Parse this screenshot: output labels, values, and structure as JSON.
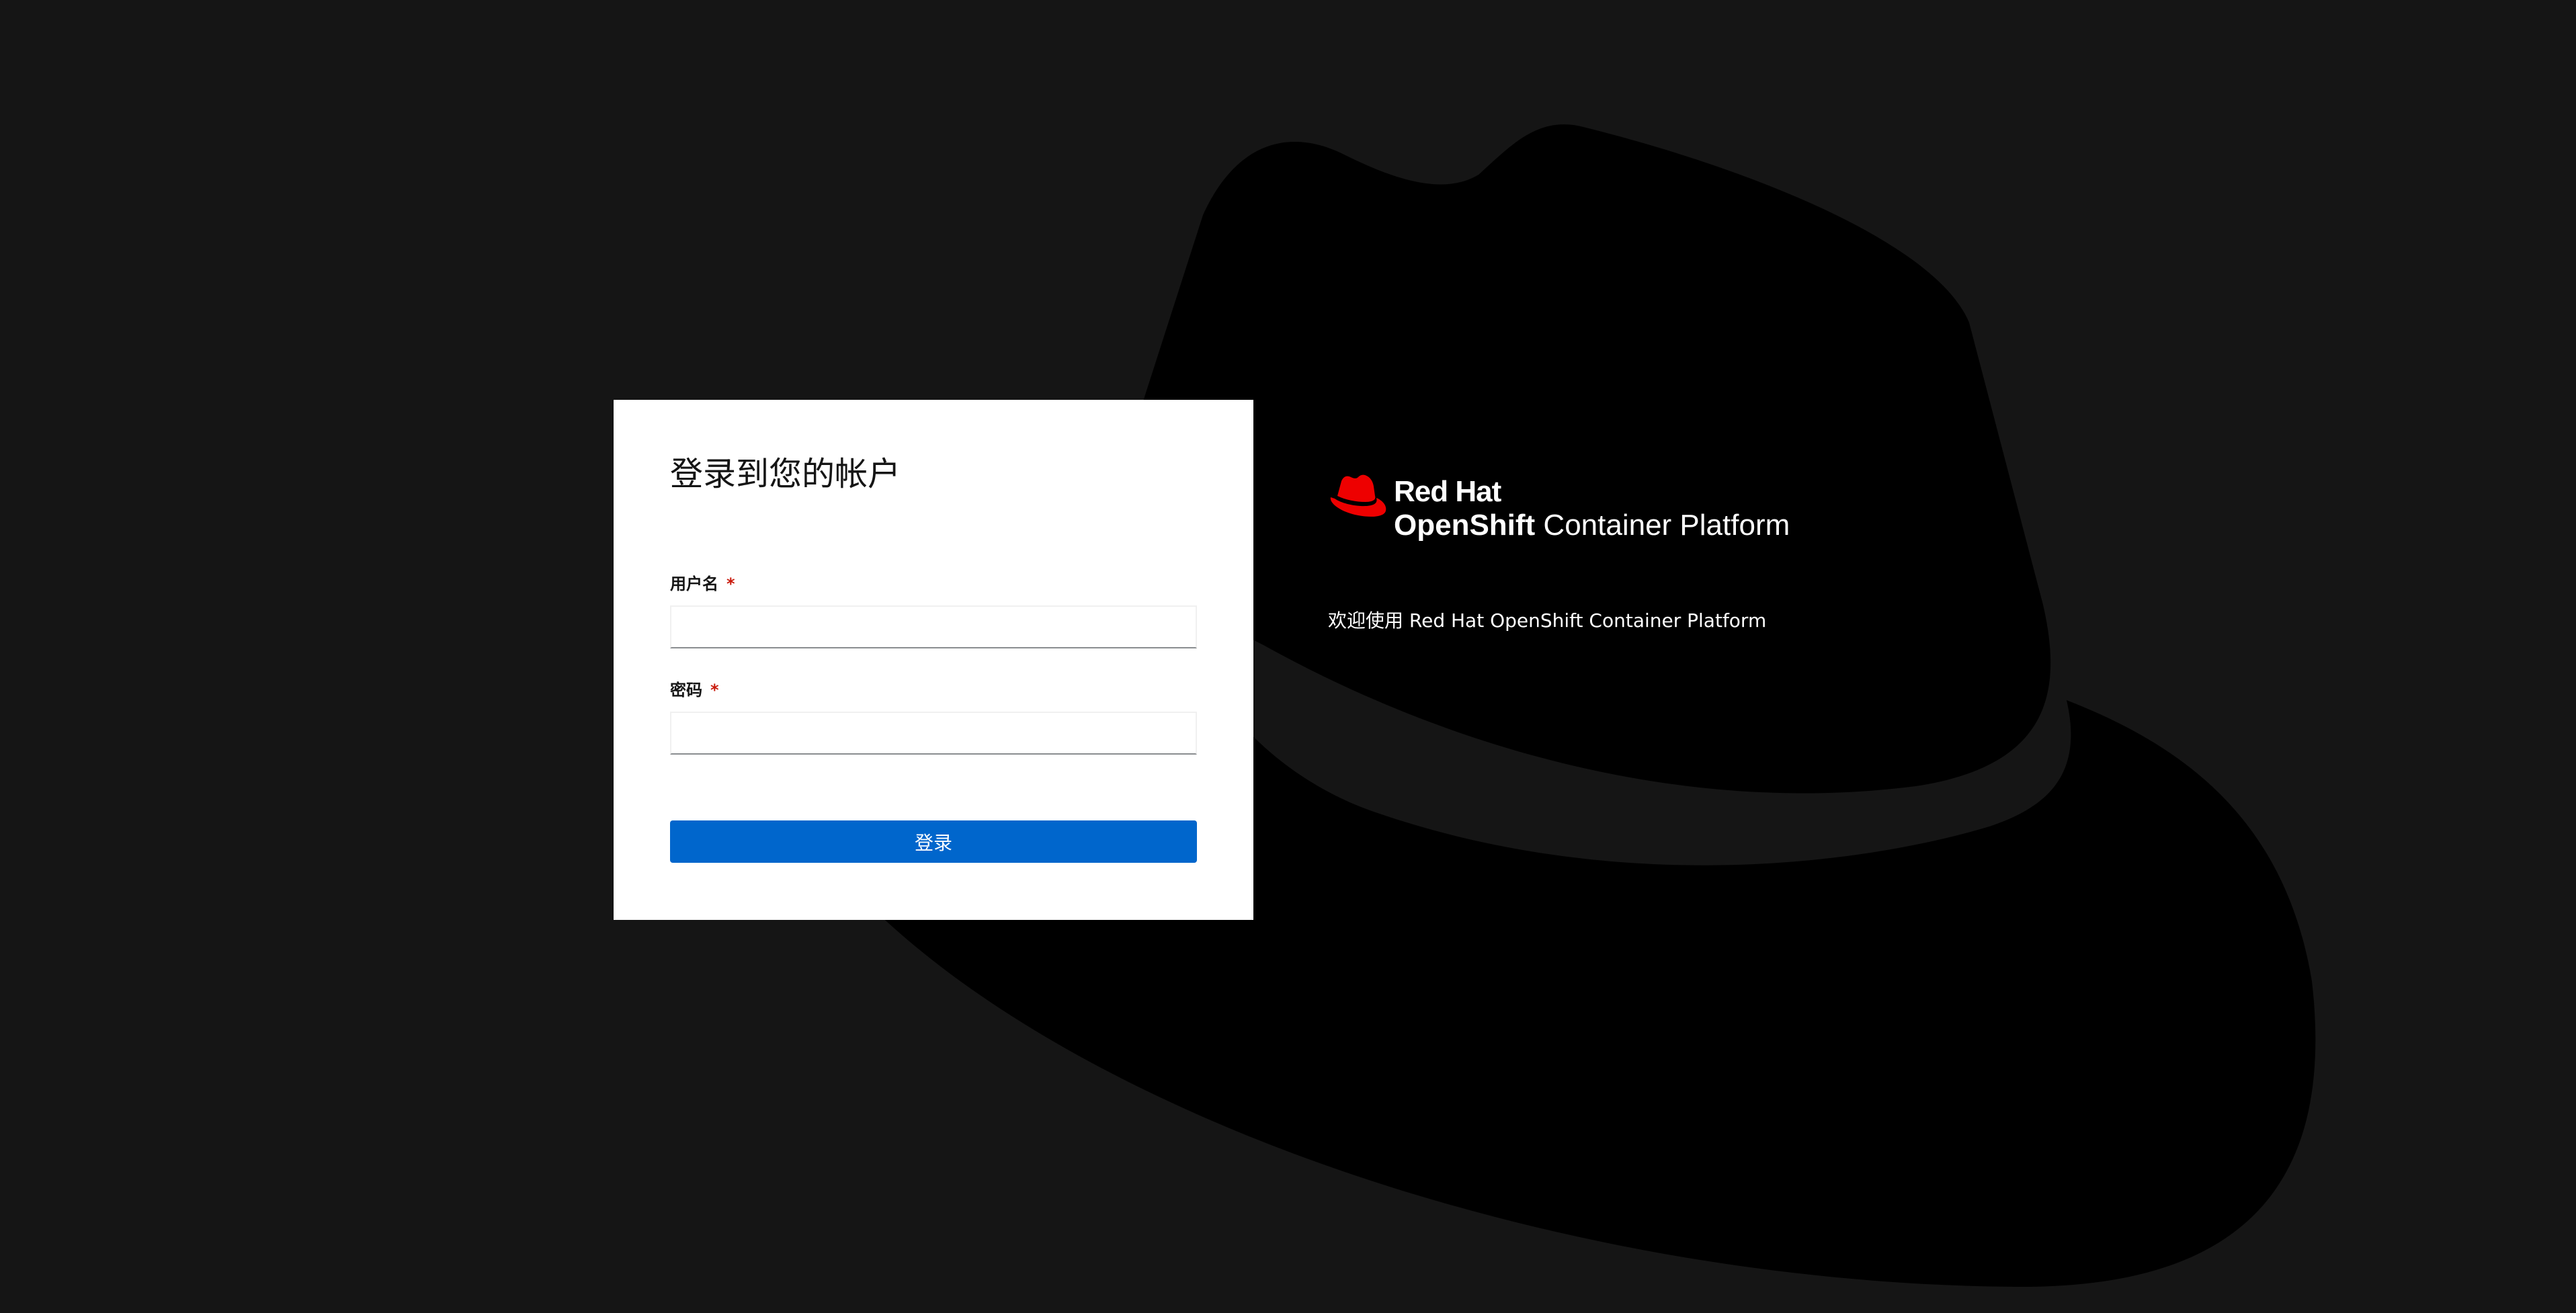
{
  "login": {
    "title": "登录到您的帐户",
    "username_label": "用户名",
    "username_required_mark": "*",
    "username_value": "",
    "password_label": "密码",
    "password_required_mark": "*",
    "password_value": "",
    "submit_label": "登录"
  },
  "brand": {
    "company": "Red Hat",
    "product_strong": "OpenShift",
    "product_rest": " Container Platform",
    "logo_icon": "redhat-hat-icon",
    "background_icon": "fedora-hat-silhouette",
    "accent_color": "#ee0000"
  },
  "welcome": {
    "text": "欢迎使用 Red Hat OpenShift Container Platform"
  },
  "colors": {
    "page_background": "#151515",
    "hat_silhouette": "#000000",
    "card_background": "#ffffff",
    "primary_button": "#0066cc",
    "required_mark": "#c9190b"
  }
}
